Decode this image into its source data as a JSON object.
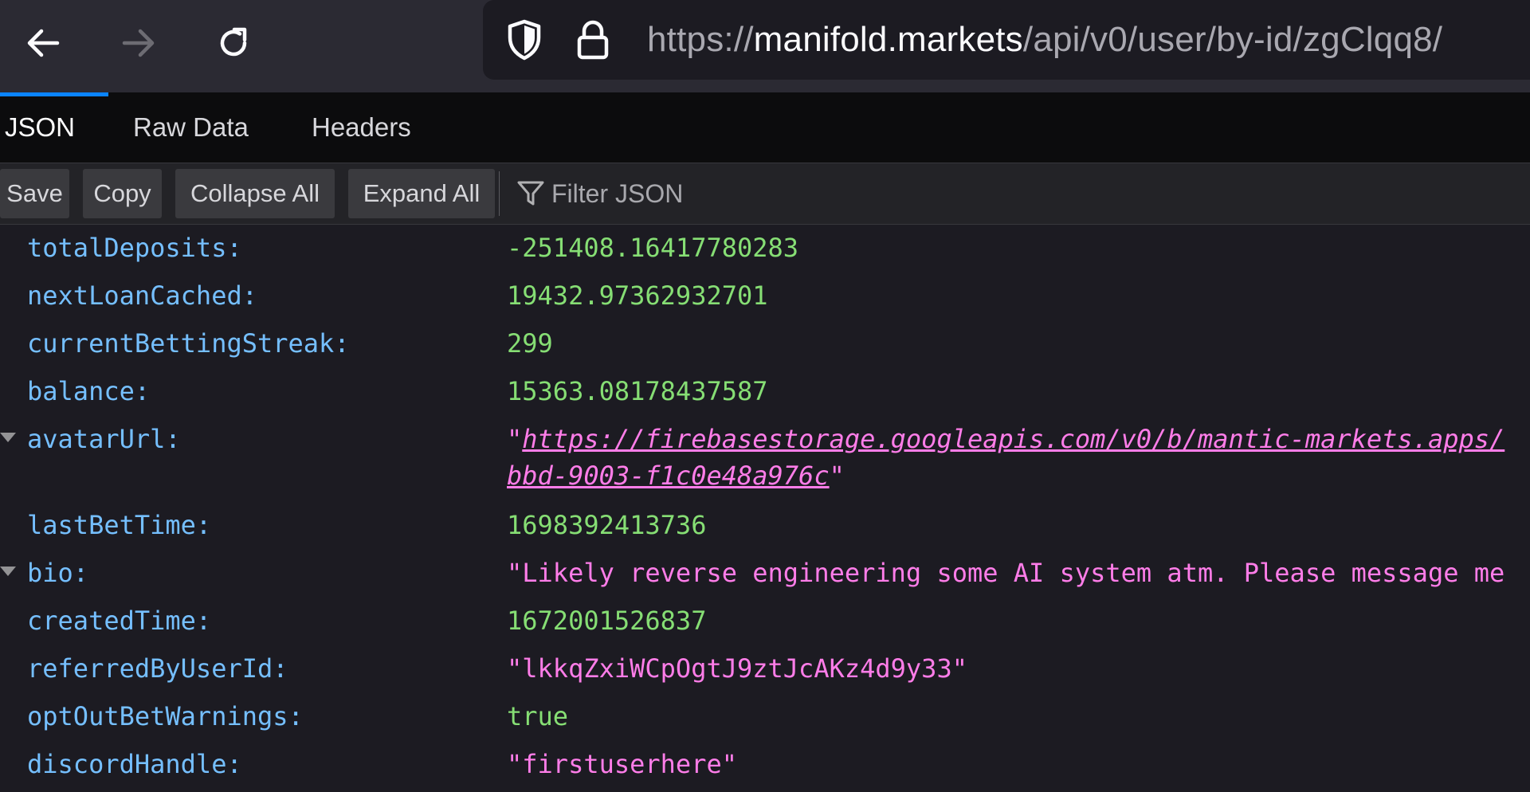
{
  "browser": {
    "url_scheme": "https://",
    "url_host": "manifold.markets",
    "url_path": "/api/v0/user/by-id/zgClqq8/",
    "icons": [
      "back-arrow-icon",
      "forward-arrow-icon",
      "reload-icon",
      "shield-icon",
      "lock-icon"
    ]
  },
  "tabs": [
    {
      "label": "JSON",
      "active": true
    },
    {
      "label": "Raw Data",
      "active": false
    },
    {
      "label": "Headers",
      "active": false
    }
  ],
  "actions": {
    "save": "Save",
    "copy": "Copy",
    "collapse_all": "Collapse All",
    "expand_all": "Expand All",
    "filter_placeholder": "Filter JSON"
  },
  "json_rows": {
    "totalDeposits": {
      "key": "totalDeposits:",
      "value": "-251408.16417780283"
    },
    "nextLoanCached": {
      "key": "nextLoanCached:",
      "value": "19432.97362932701"
    },
    "currentBettingStreak": {
      "key": "currentBettingStreak:",
      "value": "299"
    },
    "balance": {
      "key": "balance:",
      "value": "15363.08178437587"
    },
    "avatarUrl": {
      "key": "avatarUrl:",
      "line1": "https://firebasestorage.googleapis.com/v0/b/mantic-markets.apps/",
      "line2": "bbd-9003-f1c0e48a976c"
    },
    "lastBetTime": {
      "key": "lastBetTime:",
      "value": "1698392413736"
    },
    "bio": {
      "key": "bio:",
      "value": "\"Likely reverse engineering some AI system atm. Please message me"
    },
    "createdTime": {
      "key": "createdTime:",
      "value": "1672001526837"
    },
    "referredByUserId": {
      "key": "referredByUserId:",
      "value": "\"lkkqZxiWCpOgtJ9ztJcAKz4d9y33\""
    },
    "optOutBetWarnings": {
      "key": "optOutBetWarnings:",
      "value": "true"
    },
    "discordHandle": {
      "key": "discordHandle:",
      "value": "\"firstuserhere\""
    }
  },
  "colors": {
    "key": "#75bfff",
    "number": "#86de74",
    "string": "#ff7de9",
    "accent": "#0a84ff"
  }
}
